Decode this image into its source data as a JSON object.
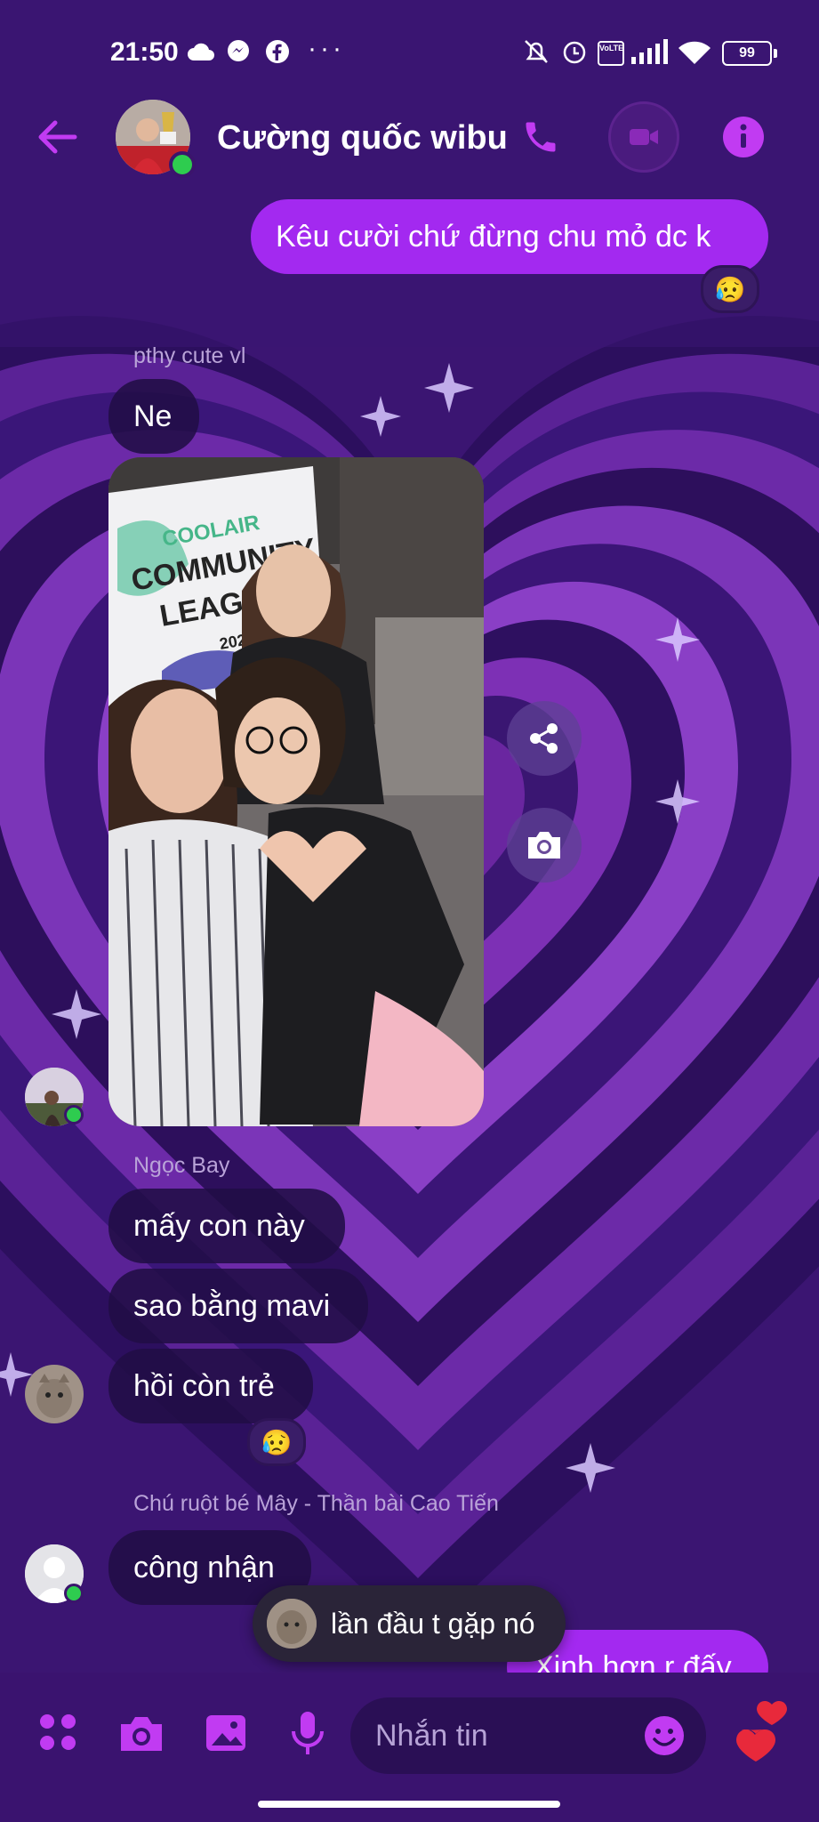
{
  "status_bar": {
    "time": "21:50",
    "more": "···",
    "battery": "99",
    "network": "VoLTE"
  },
  "header": {
    "title": "Cường quốc wibu"
  },
  "messages": [
    {
      "id": "m1",
      "direction": "outgoing",
      "text": "Kêu cười chứ đừng chu mỏ dc k",
      "reaction": "😥"
    },
    {
      "id": "m2",
      "direction": "incoming",
      "sender": "pthy cute vl",
      "text": "Ne"
    },
    {
      "id": "m3",
      "direction": "incoming",
      "type": "photo",
      "text": ""
    },
    {
      "id": "m4",
      "direction": "incoming",
      "sender": "Ngọc Bay",
      "text": "mấy con này"
    },
    {
      "id": "m5",
      "direction": "incoming",
      "text": "sao bằng mavi"
    },
    {
      "id": "m6",
      "direction": "incoming",
      "text": "hồi còn trẻ",
      "reaction": "😥"
    },
    {
      "id": "m7",
      "direction": "incoming",
      "sender": "Chú ruột bé Mây - Thần bài Cao Tiến",
      "text": "công nhận"
    },
    {
      "id": "m8",
      "direction": "outgoing",
      "text": "Xinh hơn r đấy"
    }
  ],
  "photo_text": {
    "line1": "COOLAIR",
    "line2": "COMMUNITY",
    "line3": "LEAGUE",
    "line4": "2023"
  },
  "toast": {
    "text": "lần đầu t gặp nó"
  },
  "composer": {
    "placeholder": "Nhắn tin"
  },
  "colors": {
    "accent": "#a329f0",
    "icon": "#c13bf2",
    "background": "#3a1573",
    "online": "#2ecc4f",
    "heart": "#e8293b"
  },
  "icons": [
    "back-arrow-icon",
    "phone-icon",
    "video-icon",
    "info-icon",
    "share-icon",
    "camera-icon",
    "apps-icon",
    "gallery-icon",
    "microphone-icon",
    "emoji-icon",
    "heart-icon"
  ]
}
